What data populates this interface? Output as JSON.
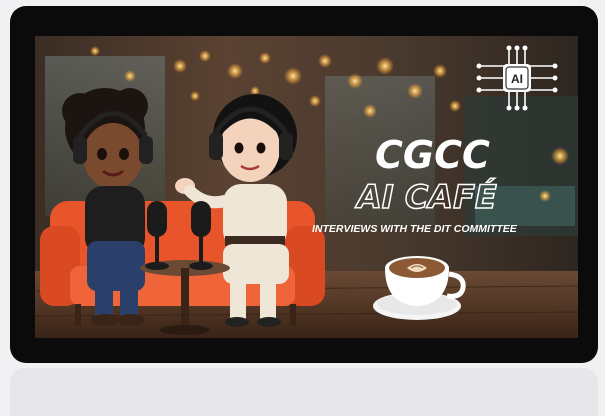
{
  "poster": {
    "ai_badge": "AI",
    "title_line1": "CGCC",
    "title_line2": "AI CAFÉ",
    "subtitle": "INTERVIEWS WITH THE DIT COMMITTEE"
  },
  "colors": {
    "frame": "#0b0b0b",
    "page_background": "#f1f1f3",
    "caption_bar": "#e7e7ea",
    "sofa": "#e8552b",
    "title_text": "#ffffff"
  },
  "icons": [
    "ai-chip-icon",
    "microphone-icon",
    "coffee-cup-icon"
  ]
}
